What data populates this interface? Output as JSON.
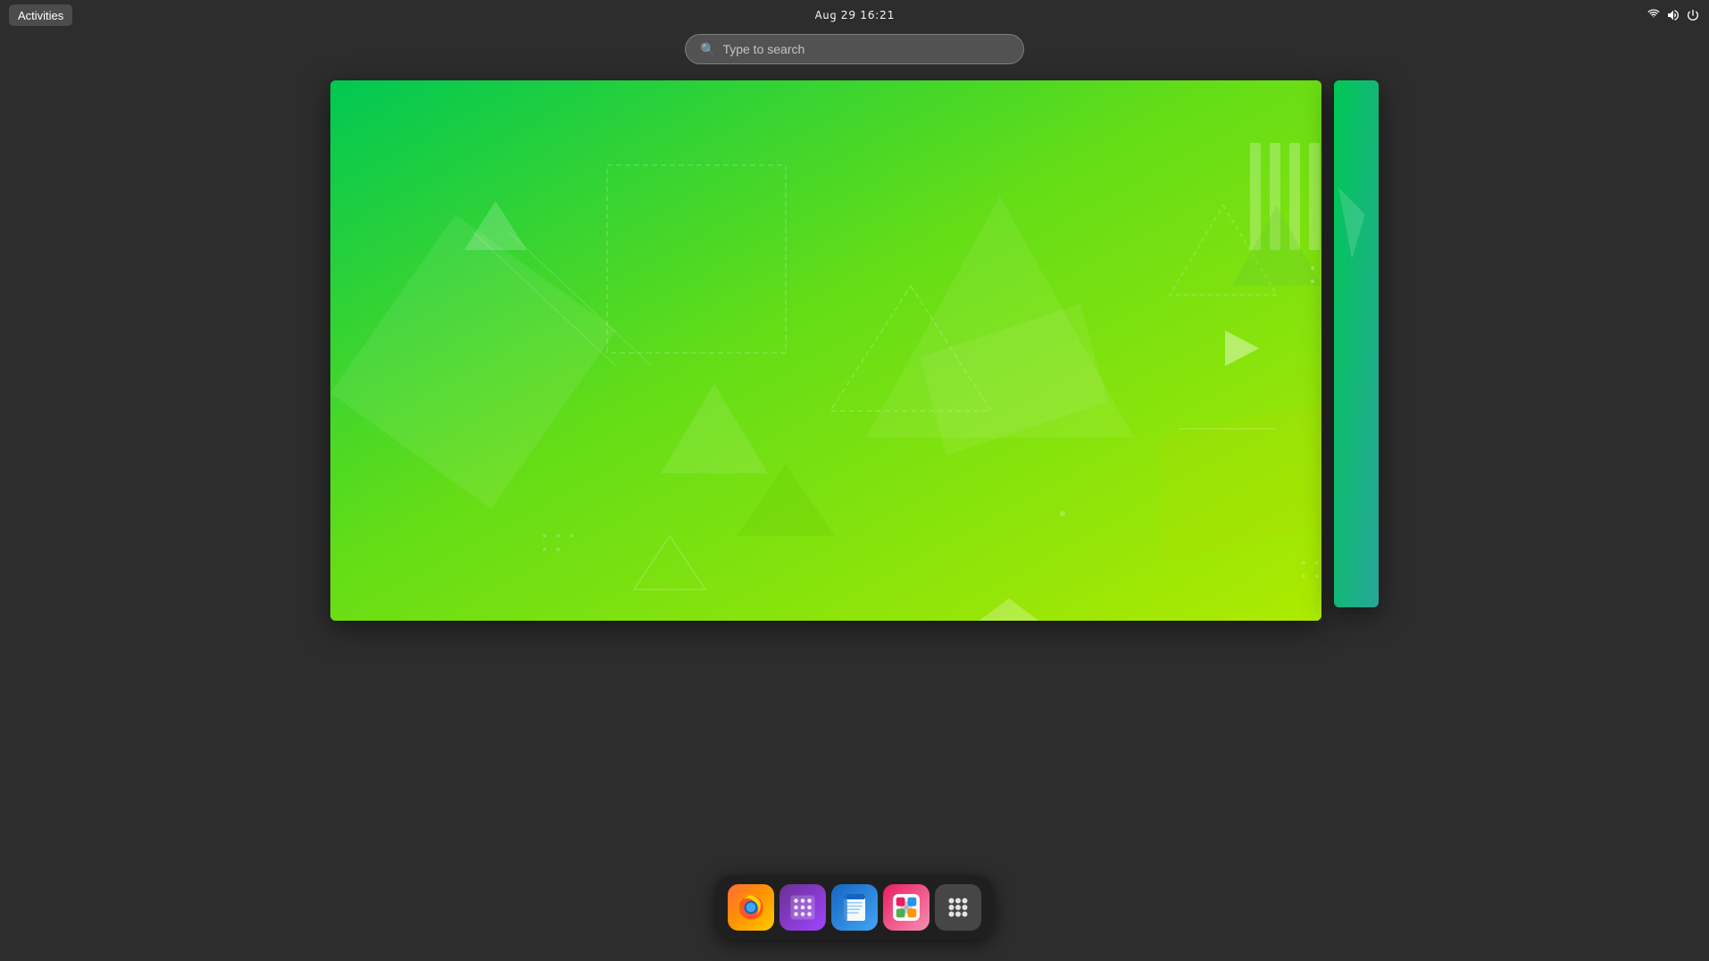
{
  "topbar": {
    "activities_label": "Activities",
    "clock": "Aug 29  16:21"
  },
  "search": {
    "placeholder": "Type to search"
  },
  "dock": {
    "icons": [
      {
        "name": "firefox",
        "label": "Firefox"
      },
      {
        "name": "calendar",
        "label": "Calendar"
      },
      {
        "name": "writer",
        "label": "Writer"
      },
      {
        "name": "store",
        "label": "Software"
      },
      {
        "name": "grid",
        "label": "Show Apps"
      }
    ]
  },
  "colors": {
    "background": "#2d2d2d",
    "accent_green": "#00c853",
    "accent_yellow": "#aeea00"
  }
}
